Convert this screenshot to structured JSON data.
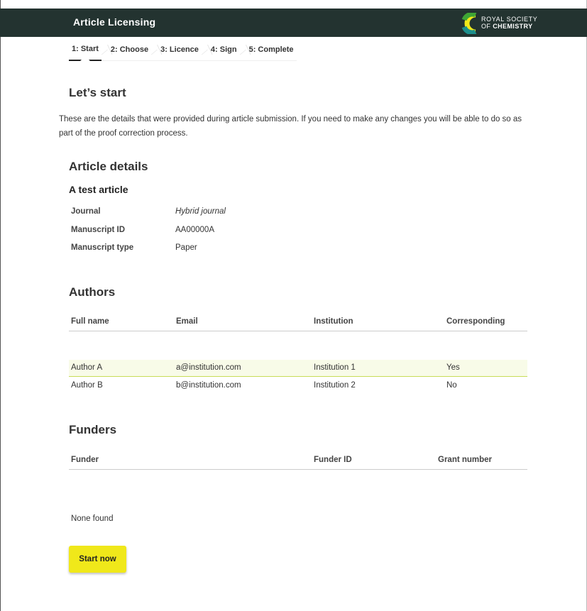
{
  "app": {
    "title": "Article Licensing"
  },
  "logo": {
    "line1": "ROYAL SOCIETY",
    "line2a": "OF ",
    "line2b": "CHEMISTRY",
    "colors": {
      "yellow": "#f0e81a",
      "green": "#3fa535",
      "teal": "#1d8f8c"
    }
  },
  "steps": [
    {
      "label": "1: Start",
      "active": true
    },
    {
      "label": "2: Choose",
      "active": false
    },
    {
      "label": "3: Licence",
      "active": false
    },
    {
      "label": "4: Sign",
      "active": false
    },
    {
      "label": "5: Complete",
      "active": false
    }
  ],
  "start": {
    "heading": "Let’s start",
    "intro": "These are the details that were provided during article submission. If you need to make any changes you will be able to do so as part of the proof correction process."
  },
  "article": {
    "heading": "Article details",
    "title": "A test article",
    "details": [
      {
        "label": "Journal",
        "value": "Hybrid journal"
      },
      {
        "label": "Manuscript ID",
        "value": "AA00000A"
      },
      {
        "label": "Manuscript type",
        "value": "Paper"
      }
    ]
  },
  "authors": {
    "heading": "Authors",
    "columns": [
      "Full name",
      "Email",
      "Institution",
      "Corresponding"
    ],
    "rows": [
      [
        "Author A",
        "a@institution.com",
        "Institution 1",
        "Yes"
      ],
      [
        "Author B",
        "b@institution.com",
        "Institution 2",
        "No"
      ]
    ]
  },
  "funders": {
    "heading": "Funders",
    "columns": [
      "Funder",
      "Funder ID",
      "Grant number"
    ],
    "empty_text": "None found"
  },
  "actions": {
    "start_label": "Start now"
  },
  "colors": {
    "header_bg": "#233330",
    "button_bg": "#f0e81a",
    "row_highlight": "#f8fbe8",
    "row_border": "#c8dc57"
  }
}
